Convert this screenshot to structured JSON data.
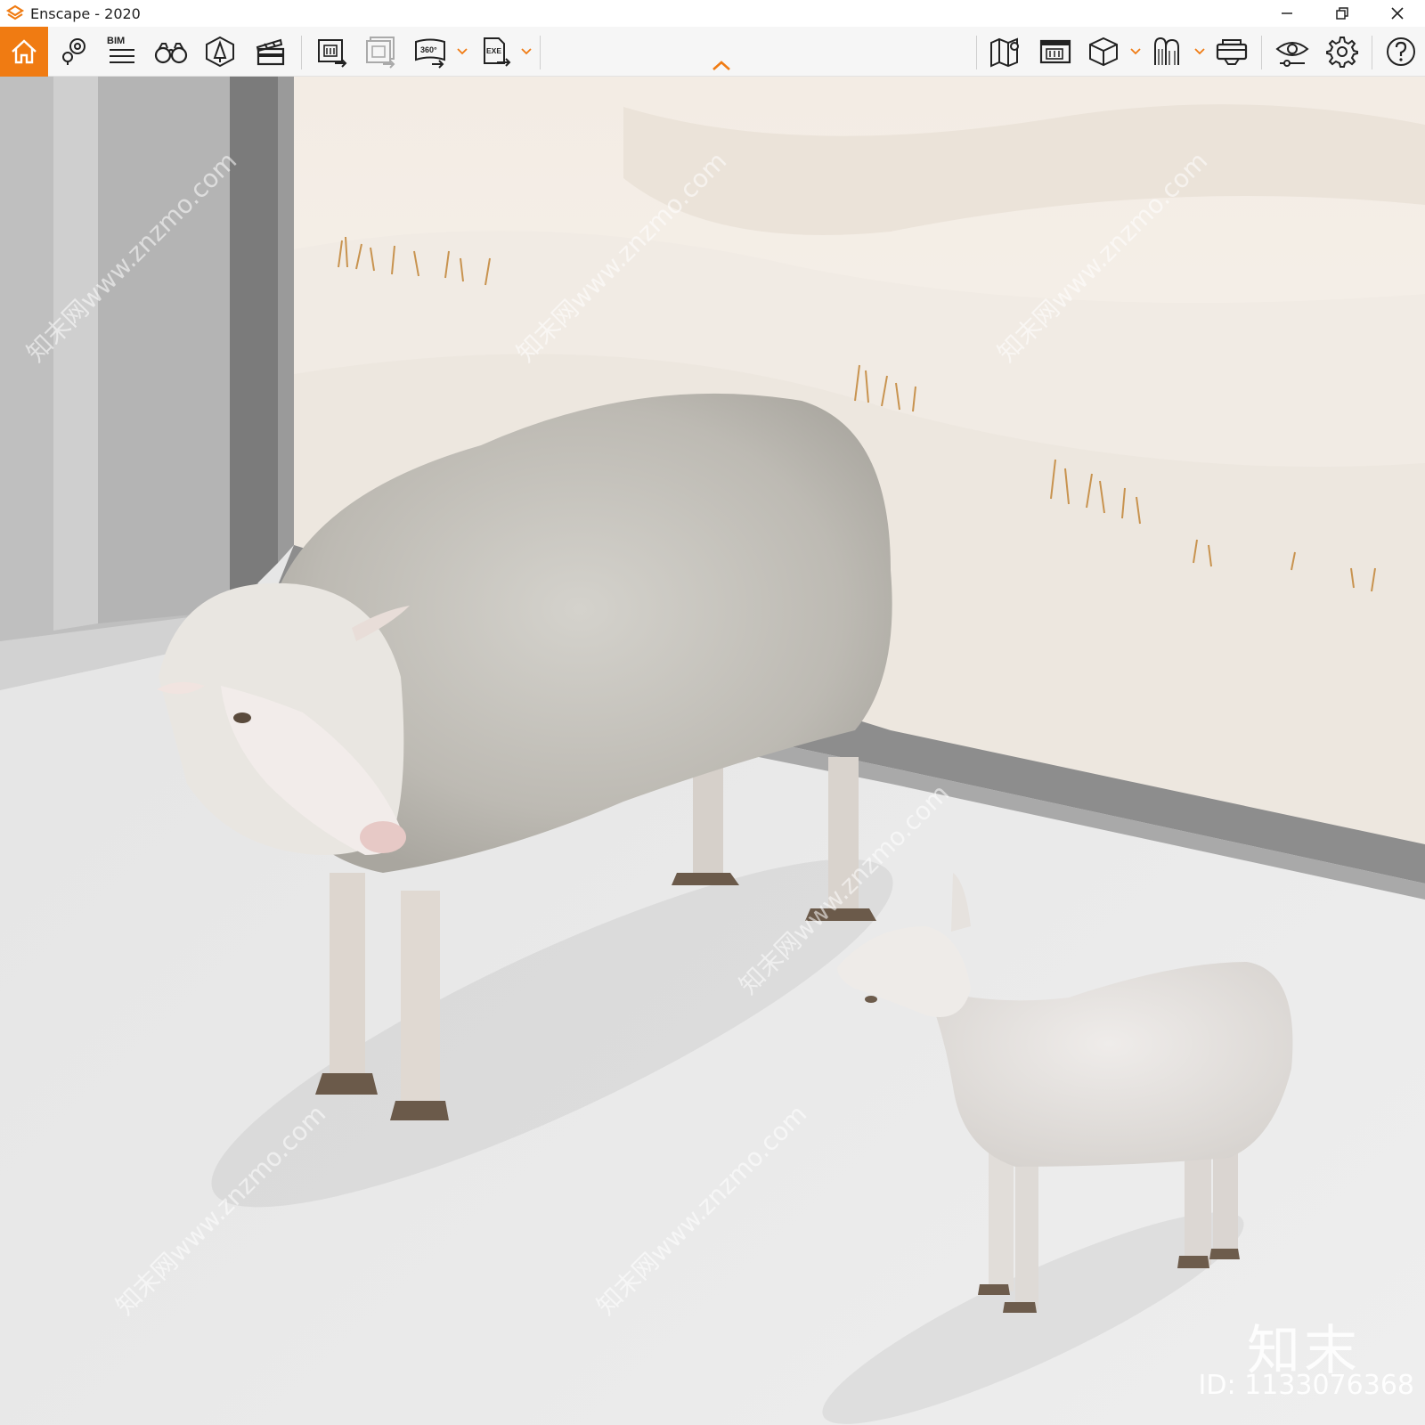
{
  "window": {
    "title": "Enscape - 2020",
    "controls": [
      "minimize",
      "restore",
      "close"
    ]
  },
  "toolbar": {
    "left_buttons": [
      {
        "name": "home",
        "icon": "home-icon",
        "active": true
      },
      {
        "name": "views",
        "icon": "map-pin-icon"
      },
      {
        "name": "bim",
        "icon": "bim-icon",
        "label": "BIM"
      },
      {
        "name": "binoculars",
        "icon": "binoculars-icon"
      },
      {
        "name": "atmosphere",
        "icon": "atmosphere-icon"
      },
      {
        "name": "video-editor",
        "icon": "clapperboard-icon"
      },
      {
        "name": "render-screenshot",
        "icon": "render-image-icon"
      },
      {
        "name": "batch-render",
        "icon": "batch-render-icon"
      },
      {
        "name": "panorama-360",
        "icon": "panorama-icon",
        "label": "360°"
      },
      {
        "name": "export-exe",
        "icon": "export-exe-icon",
        "label": "EXE"
      }
    ],
    "right_buttons": [
      {
        "name": "map",
        "icon": "map-icon"
      },
      {
        "name": "collaborative-annotation",
        "icon": "annotation-icon"
      },
      {
        "name": "asset-library",
        "icon": "cube-icon"
      },
      {
        "name": "material-editor",
        "icon": "material-icon"
      },
      {
        "name": "vr-headset",
        "icon": "vr-headset-icon"
      },
      {
        "name": "visual-settings",
        "icon": "eye-settings-icon"
      },
      {
        "name": "general-settings",
        "icon": "gear-icon"
      },
      {
        "name": "help",
        "icon": "help-icon"
      }
    ],
    "accent_color": "#f07b12"
  },
  "viewport": {
    "watermark_brand": "知末",
    "watermark_id": "ID: 1133076368",
    "watermark_repeat": "知末网www.znzmo.com"
  }
}
